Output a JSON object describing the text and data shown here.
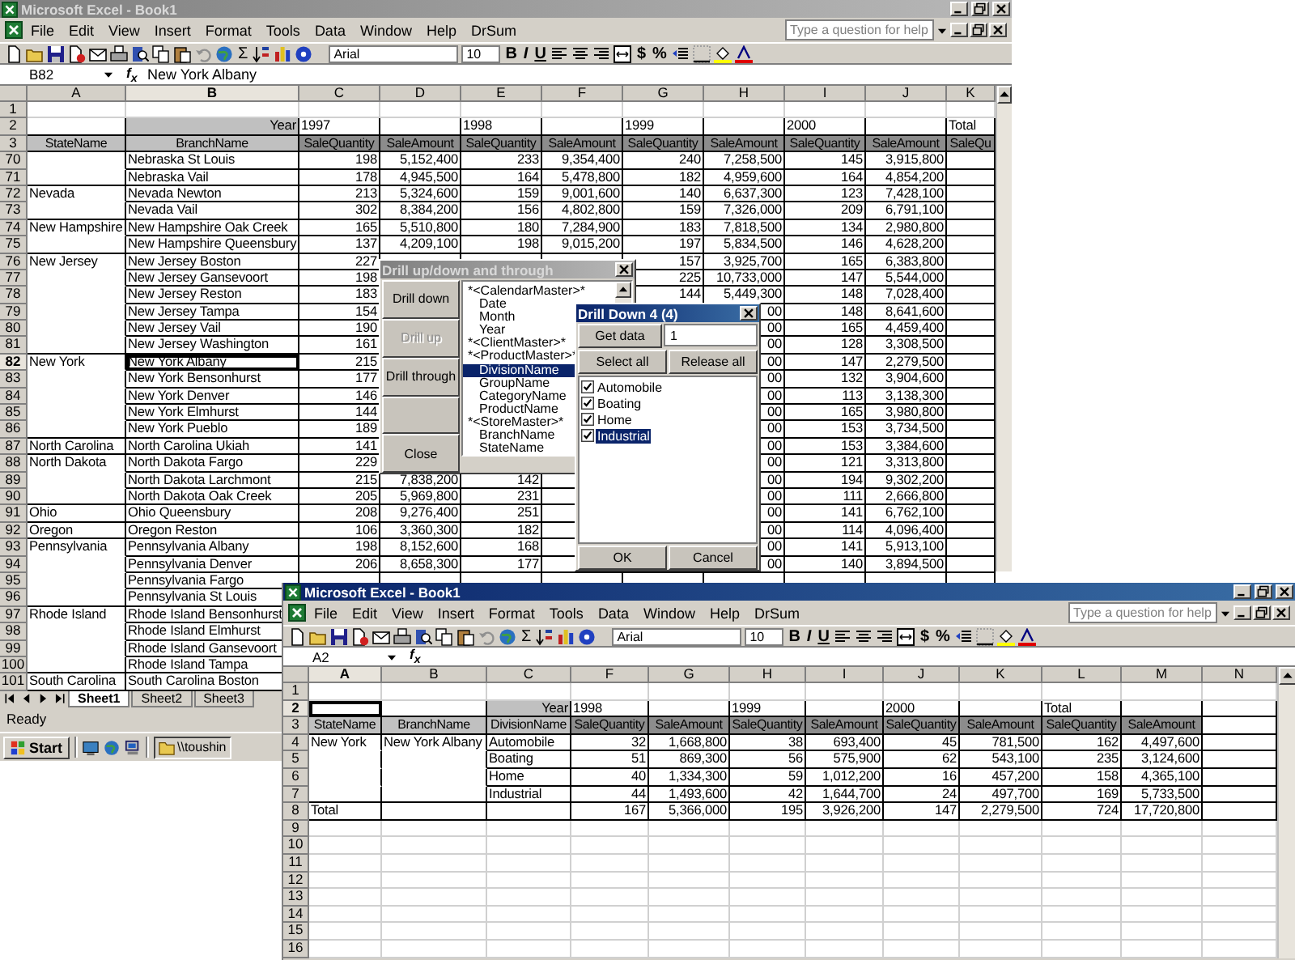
{
  "back_window": {
    "title": "Microsoft Excel - Book1",
    "active": false,
    "menu": [
      "File",
      "Edit",
      "View",
      "Insert",
      "Format",
      "Tools",
      "Data",
      "Window",
      "Help",
      "DrSum"
    ],
    "help_placeholder": "Type a question for help",
    "toolbar": {
      "sum": "Σ",
      "font": "Arial",
      "size": "10",
      "bold": "B",
      "italic": "I",
      "underline": "U",
      "currency": "$",
      "percent": "%"
    },
    "name_box": "B82",
    "fx": "f$_{x}$",
    "formula": "New York Albany",
    "columns": [
      {
        "label": "A",
        "selected": false,
        "kind": "label"
      },
      {
        "label": "B",
        "selected": true,
        "kind": "label"
      },
      {
        "label": "C",
        "selected": false,
        "kind": "value"
      },
      {
        "label": "D",
        "selected": false,
        "kind": "value"
      },
      {
        "label": "E",
        "selected": false,
        "kind": "value"
      },
      {
        "label": "F",
        "selected": false,
        "kind": "value"
      },
      {
        "label": "G",
        "selected": false,
        "kind": "value"
      },
      {
        "label": "H",
        "selected": false,
        "kind": "value"
      },
      {
        "label": "I",
        "selected": false,
        "kind": "value"
      },
      {
        "label": "J",
        "selected": false,
        "kind": "value"
      },
      {
        "label": "K",
        "selected": false,
        "kind": "value"
      }
    ],
    "rows": [
      {
        "number": "1",
        "kind": "blank",
        "selected": false
      },
      {
        "number": "2",
        "kind": "year",
        "selected": false,
        "cells": [
          null,
          "Year",
          "1997",
          null,
          "1998",
          null,
          "1999",
          null,
          "2000",
          null,
          "Total"
        ]
      },
      {
        "number": "3",
        "kind": "header",
        "selected": false,
        "cells": [
          "StateName",
          "BranchName",
          "SaleQuantity",
          "SaleAmount",
          "SaleQuantity",
          "SaleAmount",
          "SaleQuantity",
          "SaleAmount",
          "SaleQuantity",
          "SaleAmount",
          "SaleQu"
        ]
      },
      {
        "number": "70",
        "kind": "data",
        "selected": false,
        "cells": [
          null,
          "Nebraska St Louis",
          "198",
          "5,152,400",
          "233",
          "9,354,400",
          "240",
          "7,258,500",
          "145",
          "3,915,800"
        ]
      },
      {
        "number": "71",
        "kind": "data",
        "selected": false,
        "cells": [
          null,
          "Nebraska Vail",
          "178",
          "4,945,500",
          "164",
          "5,478,800",
          "182",
          "4,959,600",
          "164",
          "4,854,200"
        ]
      },
      {
        "number": "72",
        "kind": "data",
        "selected": false,
        "cells": [
          "Nevada",
          "Nevada Newton",
          "213",
          "5,324,600",
          "159",
          "9,001,600",
          "140",
          "6,637,300",
          "123",
          "7,428,100"
        ]
      },
      {
        "number": "73",
        "kind": "data",
        "selected": false,
        "cells": [
          null,
          "Nevada Vail",
          "302",
          "8,384,200",
          "156",
          "4,802,800",
          "159",
          "7,326,000",
          "209",
          "6,791,100"
        ]
      },
      {
        "number": "74",
        "kind": "data",
        "selected": false,
        "cells": [
          "New Hampshire",
          "New Hampshire Oak Creek",
          "165",
          "5,510,800",
          "180",
          "7,284,900",
          "183",
          "7,818,500",
          "134",
          "2,980,800"
        ]
      },
      {
        "number": "75",
        "kind": "data",
        "selected": false,
        "cells": [
          null,
          "New Hampshire Queensbury",
          "137",
          "4,209,100",
          "198",
          "9,015,200",
          "197",
          "5,834,500",
          "146",
          "4,628,200"
        ]
      },
      {
        "number": "76",
        "kind": "data",
        "selected": false,
        "cells": [
          "New Jersey",
          "New Jersey Boston",
          "227",
          null,
          null,
          null,
          "157",
          "3,925,700",
          "165",
          "6,383,800"
        ]
      },
      {
        "number": "77",
        "kind": "data",
        "selected": false,
        "cells": [
          null,
          "New Jersey Gansevoort",
          "198",
          null,
          null,
          null,
          "225",
          "10,733,000",
          "147",
          "5,544,000"
        ]
      },
      {
        "number": "78",
        "kind": "data",
        "selected": false,
        "cells": [
          null,
          "New Jersey Reston",
          "183",
          null,
          null,
          null,
          "144",
          "5,449,300",
          "148",
          "7,028,400"
        ]
      },
      {
        "number": "79",
        "kind": "data",
        "selected": false,
        "cells": [
          null,
          "New Jersey Tampa",
          "154",
          null,
          null,
          null,
          null,
          "00",
          "148",
          "8,641,600"
        ]
      },
      {
        "number": "80",
        "kind": "data",
        "selected": false,
        "cells": [
          null,
          "New Jersey Vail",
          "190",
          null,
          null,
          null,
          null,
          "00",
          "165",
          "4,459,400"
        ]
      },
      {
        "number": "81",
        "kind": "data",
        "selected": false,
        "cells": [
          null,
          "New Jersey Washington",
          "161",
          null,
          null,
          null,
          null,
          "00",
          "128",
          "3,308,500"
        ]
      },
      {
        "number": "82",
        "kind": "data",
        "selected": true,
        "cells": [
          "New York",
          "New York Albany",
          "215",
          null,
          null,
          null,
          null,
          "00",
          "147",
          "2,279,500"
        ]
      },
      {
        "number": "83",
        "kind": "data",
        "selected": false,
        "cells": [
          null,
          "New York Bensonhurst",
          "177",
          null,
          null,
          null,
          null,
          "00",
          "132",
          "3,904,600"
        ]
      },
      {
        "number": "84",
        "kind": "data",
        "selected": false,
        "cells": [
          null,
          "New York Denver",
          "146",
          null,
          null,
          null,
          null,
          "00",
          "113",
          "3,138,300"
        ]
      },
      {
        "number": "85",
        "kind": "data",
        "selected": false,
        "cells": [
          null,
          "New York Elmhurst",
          "144",
          null,
          null,
          null,
          null,
          "00",
          "165",
          "3,980,800"
        ]
      },
      {
        "number": "86",
        "kind": "data",
        "selected": false,
        "cells": [
          null,
          "New York Pueblo",
          "189",
          null,
          null,
          null,
          null,
          "00",
          "153",
          "3,734,500"
        ]
      },
      {
        "number": "87",
        "kind": "data",
        "selected": false,
        "cells": [
          "North Carolina",
          "North Carolina Ukiah",
          "141",
          null,
          null,
          null,
          null,
          "00",
          "153",
          "3,384,600"
        ]
      },
      {
        "number": "88",
        "kind": "data",
        "selected": false,
        "cells": [
          "North Dakota",
          "North Dakota Fargo",
          "229",
          null,
          null,
          null,
          null,
          "00",
          "121",
          "3,313,800"
        ]
      },
      {
        "number": "89",
        "kind": "data",
        "selected": false,
        "cells": [
          null,
          "North Dakota Larchmont",
          "215",
          "7,838,200",
          "142",
          null,
          null,
          "00",
          "194",
          "9,302,200"
        ]
      },
      {
        "number": "90",
        "kind": "data",
        "selected": false,
        "cells": [
          null,
          "North Dakota Oak Creek",
          "205",
          "5,969,800",
          "231",
          null,
          null,
          "00",
          "111",
          "2,666,800"
        ]
      },
      {
        "number": "91",
        "kind": "data",
        "selected": false,
        "cells": [
          "Ohio",
          "Ohio Queensbury",
          "208",
          "9,276,400",
          "251",
          null,
          null,
          "00",
          "141",
          "6,762,100"
        ]
      },
      {
        "number": "92",
        "kind": "data",
        "selected": false,
        "cells": [
          "Oregon",
          "Oregon Reston",
          "106",
          "3,360,300",
          "182",
          null,
          null,
          "00",
          "114",
          "4,096,400"
        ]
      },
      {
        "number": "93",
        "kind": "data",
        "selected": false,
        "cells": [
          "Pennsylvania",
          "Pennsylvania Albany",
          "198",
          "8,152,600",
          "168",
          null,
          null,
          "00",
          "141",
          "5,913,100"
        ]
      },
      {
        "number": "94",
        "kind": "data",
        "selected": false,
        "cells": [
          null,
          "Pennsylvania Denver",
          "206",
          "8,658,300",
          "177",
          null,
          null,
          "00",
          "140",
          "3,894,500"
        ]
      },
      {
        "number": "95",
        "kind": "data",
        "selected": false,
        "cells": [
          null,
          "Pennsylvania Fargo"
        ]
      },
      {
        "number": "96",
        "kind": "data",
        "selected": false,
        "cells": [
          null,
          "Pennsylvania St Louis"
        ]
      },
      {
        "number": "97",
        "kind": "data",
        "selected": false,
        "cells": [
          "Rhode Island",
          "Rhode Island Bensonhurst"
        ]
      },
      {
        "number": "98",
        "kind": "data",
        "selected": false,
        "cells": [
          null,
          "Rhode Island Elmhurst"
        ]
      },
      {
        "number": "99",
        "kind": "data",
        "selected": false,
        "cells": [
          null,
          "Rhode Island Gansevoort"
        ]
      },
      {
        "number": "100",
        "kind": "data",
        "selected": false,
        "cells": [
          null,
          "Rhode Island Tampa"
        ]
      },
      {
        "number": "101",
        "kind": "data",
        "selected": false,
        "cells": [
          "South Carolina",
          "South Carolina Boston"
        ]
      }
    ],
    "sheet_tabs": [
      {
        "label": "Sheet1",
        "selected": true
      },
      {
        "label": "Sheet2",
        "selected": false
      },
      {
        "label": "Sheet3",
        "selected": false
      }
    ],
    "status": "Ready"
  },
  "drill_dialog": {
    "title": "Drill up/down and through",
    "active": false,
    "buttons": [
      {
        "kind": "button",
        "label": "Drill down",
        "disabled": false
      },
      {
        "kind": "button",
        "label": "Drill up",
        "disabled": true
      },
      {
        "kind": "button",
        "label": "Drill through",
        "disabled": false
      },
      {
        "kind": "blank"
      },
      {
        "kind": "button",
        "label": "Close",
        "disabled": false
      }
    ],
    "fields": [
      {
        "label": "*<CalendarMaster>*",
        "selected": false,
        "children": [
          {
            "label": "Date",
            "selected": false
          },
          {
            "label": "Month",
            "selected": false
          },
          {
            "label": "Year",
            "selected": false
          }
        ]
      },
      {
        "label": "*<ClientMaster>*",
        "selected": false
      },
      {
        "label": "*<ProductMaster>*",
        "selected": false,
        "children": [
          {
            "label": "DivisionName",
            "selected": true
          },
          {
            "label": "GroupName",
            "selected": false
          },
          {
            "label": "CategoryName",
            "selected": false
          },
          {
            "label": "ProductName",
            "selected": false
          }
        ]
      },
      {
        "label": "*<StoreMaster>*",
        "selected": false,
        "children": [
          {
            "label": "BranchName",
            "selected": false
          },
          {
            "label": "StateName",
            "selected": false
          }
        ]
      }
    ]
  },
  "drill_down_dialog": {
    "title": "Drill Down  4 (4)",
    "active": true,
    "get_data": "Get data",
    "value": "1",
    "select_all": "Select all",
    "release_all": "Release all",
    "items": [
      {
        "label": "Automobile",
        "checked": true,
        "selected": false
      },
      {
        "label": "Boating",
        "checked": true,
        "selected": false
      },
      {
        "label": "Home",
        "checked": true,
        "selected": false
      },
      {
        "label": "Industrial",
        "checked": true,
        "selected": true
      }
    ],
    "ok": "OK",
    "cancel": "Cancel"
  },
  "taskbar": {
    "start": "Start",
    "tasks": [
      {
        "label": "\\\\toushin"
      }
    ]
  },
  "front_window": {
    "title": "Microsoft Excel - Book1",
    "active": true,
    "menu": [
      "File",
      "Edit",
      "View",
      "Insert",
      "Format",
      "Tools",
      "Data",
      "Window",
      "Help",
      "DrSum"
    ],
    "help_placeholder": "Type a question for help",
    "toolbar": {
      "sum": "Σ",
      "font": "Arial",
      "size": "10",
      "bold": "B",
      "italic": "I",
      "underline": "U",
      "currency": "$",
      "percent": "%"
    },
    "name_box": "A2",
    "fx": "f$_{x}$",
    "columns": [
      {
        "label": "A",
        "selected": true,
        "kind": "label"
      },
      {
        "label": "B",
        "selected": false,
        "kind": "label"
      },
      {
        "label": "C",
        "selected": false,
        "kind": "label"
      },
      {
        "label": "F",
        "selected": false,
        "kind": "value"
      },
      {
        "label": "G",
        "selected": false,
        "kind": "value"
      },
      {
        "label": "H",
        "selected": false,
        "kind": "value"
      },
      {
        "label": "I",
        "selected": false,
        "kind": "value"
      },
      {
        "label": "J",
        "selected": false,
        "kind": "value"
      },
      {
        "label": "K",
        "selected": false,
        "kind": "value"
      },
      {
        "label": "L",
        "selected": false,
        "kind": "value"
      },
      {
        "label": "M",
        "selected": false,
        "kind": "value"
      },
      {
        "label": "N",
        "selected": false,
        "kind": "value"
      }
    ],
    "rows": [
      {
        "number": "1",
        "kind": "blank",
        "selected": false
      },
      {
        "number": "2",
        "kind": "year",
        "selected": true,
        "cells": [
          null,
          null,
          "Year",
          "1998",
          null,
          "1999",
          null,
          "2000",
          null,
          "Total"
        ]
      },
      {
        "number": "3",
        "kind": "header",
        "selected": false,
        "cells": [
          "StateName",
          "BranchName",
          "DivisionName",
          "SaleQuantity",
          "SaleAmount",
          "SaleQuantity",
          "SaleAmount",
          "SaleQuantity",
          "SaleAmount",
          "SaleQuantity",
          "SaleAmount"
        ]
      },
      {
        "number": "4",
        "kind": "data",
        "selected": false,
        "cells": [
          "New York",
          "New York Albany",
          "Automobile",
          "32",
          "1,668,800",
          "38",
          "693,400",
          "45",
          "781,500",
          "162",
          "4,497,600"
        ]
      },
      {
        "number": "5",
        "kind": "data",
        "selected": false,
        "cells": [
          null,
          null,
          "Boating",
          "51",
          "869,300",
          "56",
          "575,900",
          "62",
          "543,100",
          "235",
          "3,124,600"
        ]
      },
      {
        "number": "6",
        "kind": "data",
        "selected": false,
        "cells": [
          null,
          null,
          "Home",
          "40",
          "1,334,300",
          "59",
          "1,012,200",
          "16",
          "457,200",
          "158",
          "4,365,100"
        ]
      },
      {
        "number": "7",
        "kind": "data",
        "selected": false,
        "cells": [
          null,
          null,
          "Industrial",
          "44",
          "1,493,600",
          "42",
          "1,644,700",
          "24",
          "497,700",
          "169",
          "5,733,500"
        ]
      },
      {
        "number": "8",
        "kind": "total",
        "selected": false,
        "cells": [
          "Total",
          null,
          null,
          "167",
          "5,366,000",
          "195",
          "3,926,200",
          "147",
          "2,279,500",
          "724",
          "17,720,800"
        ]
      },
      {
        "number": "9",
        "kind": "blank",
        "selected": false
      },
      {
        "number": "10",
        "kind": "blank",
        "selected": false
      },
      {
        "number": "11",
        "kind": "blank",
        "selected": false
      },
      {
        "number": "12",
        "kind": "blank",
        "selected": false
      },
      {
        "number": "13",
        "kind": "blank",
        "selected": false
      },
      {
        "number": "14",
        "kind": "blank",
        "selected": false
      },
      {
        "number": "15",
        "kind": "blank",
        "selected": false
      },
      {
        "number": "16",
        "kind": "blank",
        "selected": false
      }
    ]
  }
}
